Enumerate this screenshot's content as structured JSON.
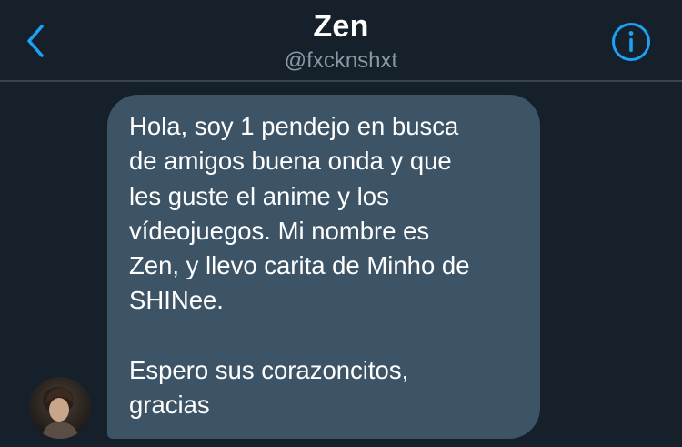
{
  "header": {
    "title": "Zen",
    "handle": "@fxcknshxt",
    "back_icon": "chevron-left-icon",
    "info_icon": "info-icon",
    "accent_color": "#1da1f2"
  },
  "message": {
    "text": "Hola, soy 1 pendejo en busca\nde amigos buena onda y que\nles guste el anime y los\nvídeojuegos. Mi nombre es\nZen, y llevo carita de Minho de\nSHINee.\n\nEspero sus corazoncitos,\ngracias",
    "bubble_color": "#3d5466"
  },
  "theme": {
    "background": "#15202b",
    "secondary_text": "#8899a6"
  }
}
